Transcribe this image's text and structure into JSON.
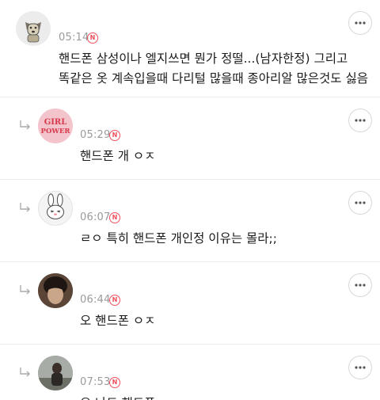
{
  "comments": [
    {
      "time": "05:14",
      "badge": "N",
      "lines": [
        "핸드폰 삼성이나 엘지쓰면 뭔가 정떨...(남자한정) 그리고",
        "똑같은 옷 계속입을때 다리털 많을때 종아리알 많은것도 싫음"
      ],
      "avatar": "dog-illustration-avatar"
    },
    {
      "time": "05:29",
      "badge": "N",
      "lines": [
        "핸드폰 개 ㅇㅈ"
      ],
      "avatar": "girl-power-avatar",
      "avatar_text": [
        "GIRL",
        "POWER"
      ]
    },
    {
      "time": "06:07",
      "badge": "N",
      "lines": [
        "ㄹㅇ 특히 핸드폰 개인정 이유는 몰라;;"
      ],
      "avatar": "rabbit-illustration-avatar"
    },
    {
      "time": "06:44",
      "badge": "N",
      "lines": [
        "오 핸드폰 ㅇㅈ"
      ],
      "avatar": "person-photo-avatar"
    },
    {
      "time": "07:53",
      "badge": "N",
      "lines": [
        "오 나도 핸드폰"
      ],
      "avatar": "person-photo-avatar-2"
    }
  ],
  "colors": {
    "badge": "#ef4f5b",
    "divider": "#ececec",
    "time": "#9a9a9a"
  },
  "icons": {
    "more": "more-horizontal-icon",
    "reply": "reply-arrow-icon"
  }
}
